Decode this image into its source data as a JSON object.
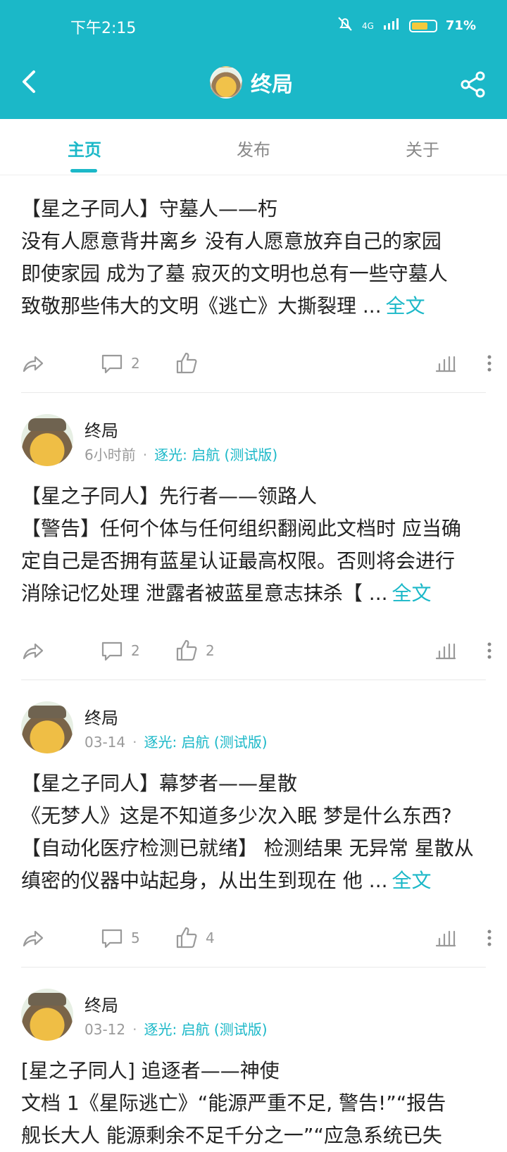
{
  "status_bar": {
    "time": "下午2:15",
    "battery": "71%",
    "network": "4G"
  },
  "header": {
    "title": "终局",
    "back_icon": "chevron-left-icon",
    "share_icon": "share-icon"
  },
  "tabs": [
    {
      "label": "主页",
      "active": true
    },
    {
      "label": "发布",
      "active": false
    },
    {
      "label": "关于",
      "active": false
    }
  ],
  "posts": [
    {
      "author": "",
      "time": "",
      "app": "",
      "lines": [
        "【星之子同人】守墓人——朽",
        "没有人愿意背井离乡 没有人愿意放弃自己的家园",
        "即使家园 成为了墓 寂灭的文明也总有一些守墓人",
        "致敬那些伟大的文明《逃亡》大撕裂理 ..."
      ],
      "more": "全文",
      "comments": "2",
      "likes": ""
    },
    {
      "author": "终局",
      "time": "6小时前",
      "app": "逐光: 启航 (测试版)",
      "lines": [
        "【星之子同人】先行者——领路人",
        "【警告】任何个体与任何组织翻阅此文档时 应当确",
        "定自己是否拥有蓝星认证最高权限。否则将会进行",
        "消除记忆处理 泄露者被蓝星意志抹杀【 ..."
      ],
      "more": "全文",
      "comments": "2",
      "likes": "2"
    },
    {
      "author": "终局",
      "time": "03-14",
      "app": "逐光: 启航 (测试版)",
      "lines": [
        "【星之子同人】幕梦者——星散",
        "《无梦人》这是不知道多少次入眠 梦是什么东西?",
        "【自动化医疗检测已就绪】 检测结果 无异常 星散从",
        "缜密的仪器中站起身，从出生到现在 他 ..."
      ],
      "more": "全文",
      "comments": "5",
      "likes": "4"
    },
    {
      "author": "终局",
      "time": "03-12",
      "app": "逐光: 启航 (测试版)",
      "lines": [
        "[星之子同人] 追逐者——神使",
        "文档 1《星际逃亡》“能源严重不足, 警告!”“报告",
        "舰长大人 能源剩余不足千分之一”“应急系统已失"
      ],
      "more": "",
      "comments": "",
      "likes": ""
    }
  ]
}
